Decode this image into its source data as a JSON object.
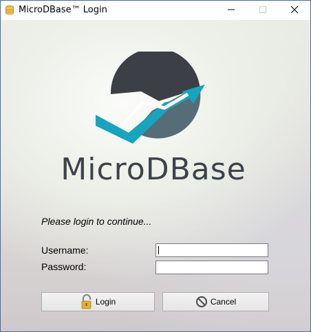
{
  "window": {
    "title": "MicroDBase™ Login",
    "app_icon": "database-icon",
    "controls": [
      "minimize-icon",
      "maximize-icon",
      "close-icon"
    ]
  },
  "brand": {
    "name": "MicroDBase",
    "logo_icon": "checkmark-trend-arrow-logo",
    "colors": {
      "dark": "#3c4046",
      "teal": "#17a4bf",
      "slate": "#566c76"
    }
  },
  "form": {
    "prompt": "Please login to continue...",
    "username_label": "Username:",
    "username_value": "",
    "password_label": "Password:",
    "password_value": ""
  },
  "buttons": {
    "login_label": "Login",
    "login_icon": "padlock-icon",
    "cancel_label": "Cancel",
    "cancel_icon": "prohibited-icon"
  }
}
